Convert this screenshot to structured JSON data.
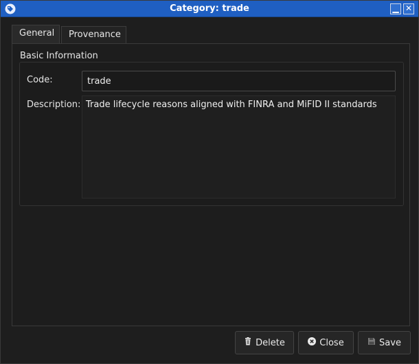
{
  "window": {
    "title": "Category: trade",
    "minimize_glyph": "▁",
    "close_glyph": "✕"
  },
  "tabs": [
    {
      "label": "General",
      "active": true
    },
    {
      "label": "Provenance",
      "active": false
    }
  ],
  "basic_info": {
    "heading": "Basic Information",
    "code_label": "Code:",
    "code_value": "trade",
    "description_label": "Description:",
    "description_value": "Trade lifecycle reasons aligned with FINRA and MiFID II standards"
  },
  "buttons": {
    "delete_label": "Delete",
    "close_label": "Close",
    "save_label": "Save"
  },
  "icons": {
    "app": "tag-icon",
    "delete": "trash-icon",
    "close": "close-circle-icon",
    "save": "save-icon"
  },
  "colors": {
    "titlebar": "#1f5fc2",
    "background": "#1e1e1e",
    "text": "#e6e6e6"
  }
}
